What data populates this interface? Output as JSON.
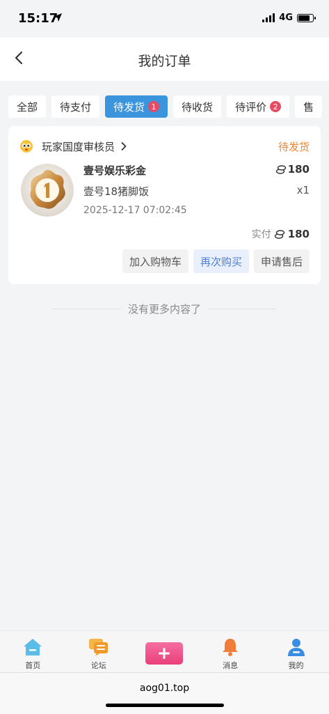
{
  "status_bar": {
    "time": "15:17",
    "network": "4G"
  },
  "nav": {
    "title": "我的订单"
  },
  "tabs": [
    {
      "label": "全部",
      "badge": null,
      "active": false
    },
    {
      "label": "待支付",
      "badge": null,
      "active": false
    },
    {
      "label": "待发货",
      "badge": "1",
      "active": true
    },
    {
      "label": "待收货",
      "badge": null,
      "active": false
    },
    {
      "label": "待评价",
      "badge": "2",
      "active": false
    },
    {
      "label": "售",
      "badge": null,
      "active": false
    }
  ],
  "order": {
    "shop_name": "玩家国度审核员",
    "status": "待发货",
    "product_name": "壹号娱乐彩金",
    "price": "180",
    "spec": "壹号18猪脚饭",
    "quantity": "x1",
    "time": "2025-12-17 07:02:45",
    "paid_label": "实付",
    "paid_amount": "180",
    "actions": {
      "add_cart": "加入购物车",
      "buy_again": "再次购买",
      "after_sale": "申请售后"
    }
  },
  "list_end_text": "没有更多内容了",
  "tabbar": {
    "home": "首页",
    "forum": "论坛",
    "messages": "消息",
    "mine": "我的"
  },
  "browser": {
    "url": "aog01.top"
  },
  "colors": {
    "accent": "#3a95dd",
    "badge": "#e64b63",
    "status_orange": "#f0832f",
    "buy_again_text": "#4a7fd8",
    "publish_pink": "#ea3f7a"
  }
}
